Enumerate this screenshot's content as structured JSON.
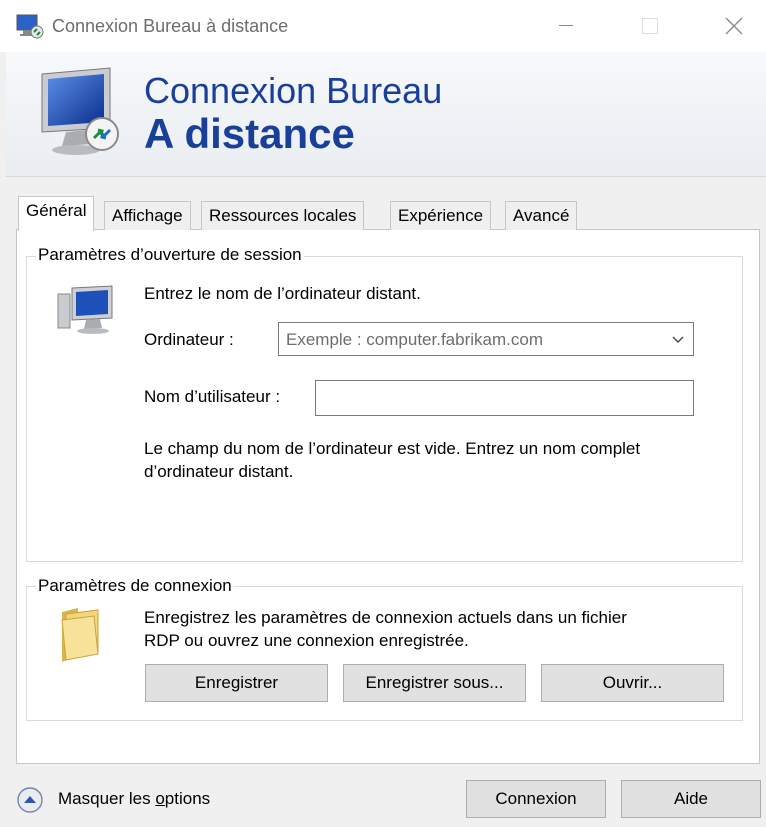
{
  "window": {
    "title": "Connexion Bureau à distance",
    "controls": {
      "minimize": "—",
      "close": "✕"
    }
  },
  "banner": {
    "line1": "Connexion Bureau",
    "line2": "A distance"
  },
  "tabs": [
    {
      "label": "Général",
      "active": true
    },
    {
      "label": "Affichage",
      "active": false
    },
    {
      "label": "Ressources locales",
      "active": false
    },
    {
      "label": "Expérience",
      "active": false
    },
    {
      "label": "Avancé",
      "active": false
    }
  ],
  "logon": {
    "legend": "Paramètres d’ouverture de session",
    "intro": "Entrez le nom de l’ordinateur distant.",
    "computer_label": "Ordinateur :",
    "computer_value": "Exemple : computer.fabrikam.com",
    "username_label": "Nom d’utilisateur :",
    "username_value": "",
    "warning_line1": "Le champ du nom de l’ordinateur est vide. Entrez un nom complet",
    "warning_line2": "d’ordinateur distant."
  },
  "connection": {
    "legend": "Paramètres de connexion",
    "desc_line1": "Enregistrez les paramètres de connexion actuels dans un fichier",
    "desc_line2": "RDP ou ouvrez une connexion enregistrée.",
    "save_label": "Enregistrer",
    "save_as_label": "Enregistrer sous...",
    "open_label": "Ouvrir..."
  },
  "footer": {
    "toggle_prefix": "Masquer les ",
    "toggle_underlined": "o",
    "toggle_suffix": "ptions",
    "connect_label": "Connexion",
    "help_label": "Aide"
  },
  "icons": {
    "title": "remote-desktop-icon",
    "banner": "remote-desktop-monitor-icon",
    "computer": "computer-icon",
    "folder": "folder-icon",
    "toggle": "chevron-up-circle-icon"
  },
  "colors": {
    "banner_text": "#1a3f99",
    "hint_text": "#6d6d6d"
  }
}
